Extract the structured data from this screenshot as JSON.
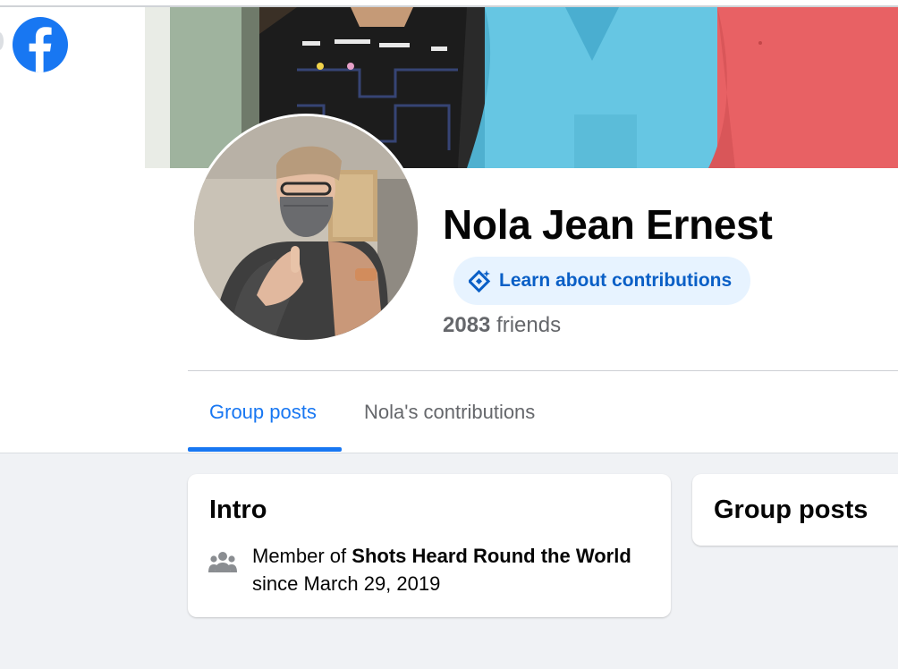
{
  "app": {
    "logo_icon": "facebook-logo-icon",
    "brand_color": "#1877f2"
  },
  "profile": {
    "name": "Nola Jean Ernest",
    "contributions_button": {
      "icon": "sparkle-diamond-icon",
      "label": "Learn about contributions"
    },
    "friends": {
      "count": "2083",
      "label": "friends"
    }
  },
  "tabs": [
    {
      "label": "Group posts",
      "active": true
    },
    {
      "label": "Nola's contributions",
      "active": false
    }
  ],
  "intro": {
    "title": "Intro",
    "icon": "members-icon",
    "prefix": "Member of",
    "group_name": "Shots Heard Round the World",
    "since": "since March 29, 2019"
  },
  "group_posts_card": {
    "title": "Group posts"
  },
  "colors": {
    "accent": "#1877f2",
    "button_bg": "#e7f3ff",
    "page_bg": "#f0f2f5",
    "muted_text": "#65676b"
  }
}
